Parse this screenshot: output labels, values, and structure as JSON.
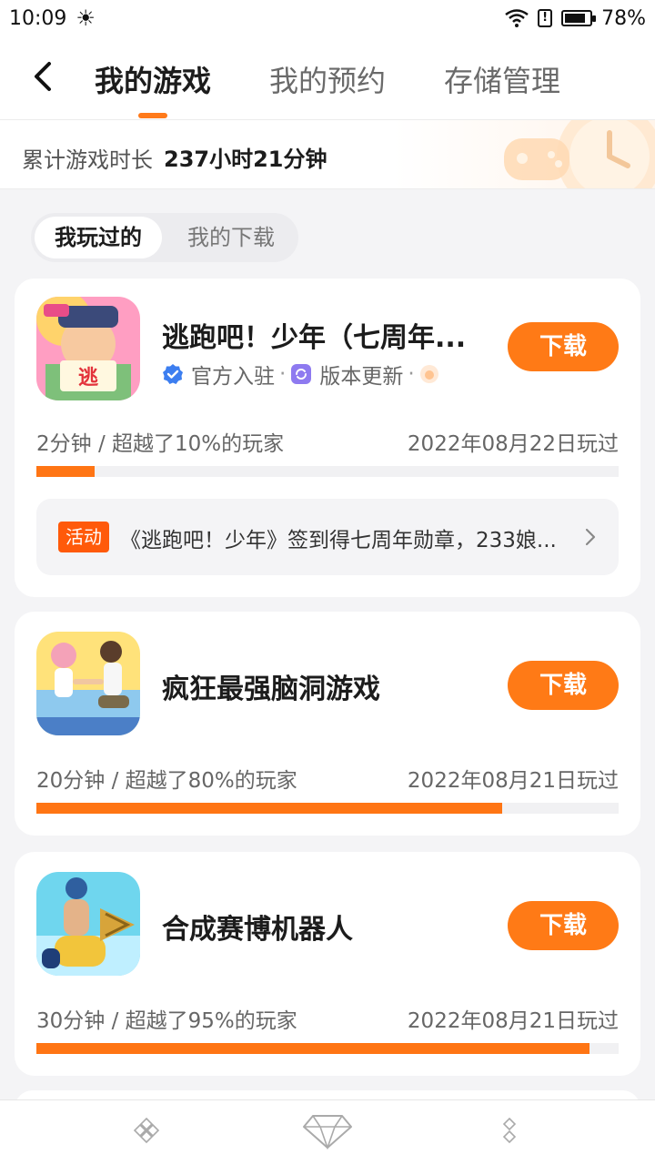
{
  "status_bar": {
    "time": "10:09",
    "battery": "78%"
  },
  "nav": {
    "tabs": [
      {
        "label": "我的游戏",
        "active": true
      },
      {
        "label": "我的预约",
        "active": false
      },
      {
        "label": "存储管理",
        "active": false
      }
    ]
  },
  "summary": {
    "label": "累计游戏时长",
    "value": "237小时21分钟"
  },
  "subtabs": [
    {
      "label": "我玩过的",
      "active": true
    },
    {
      "label": "我的下载",
      "active": false
    }
  ],
  "games": [
    {
      "title": "逃跑吧！少年（七周年...",
      "tags": [
        "官方入驻",
        "版本更新"
      ],
      "button": "下载",
      "stat": "2分钟 / 超越了10%的玩家",
      "date": "2022年08月22日玩过",
      "progress": 0.1,
      "activity": {
        "badge": "活动",
        "text": "《逃跑吧！少年》签到得七周年勋章，233娘..."
      }
    },
    {
      "title": "疯狂最强脑洞游戏",
      "button": "下载",
      "stat": "20分钟 / 超越了80%的玩家",
      "date": "2022年08月21日玩过",
      "progress": 0.8
    },
    {
      "title": "合成赛博机器人",
      "button": "下载",
      "stat": "30分钟 / 超越了95%的玩家",
      "date": "2022年08月21日玩过",
      "progress": 0.95
    }
  ],
  "colors": {
    "accent": "#ff7a16",
    "activity_badge": "#ff5a0a"
  }
}
